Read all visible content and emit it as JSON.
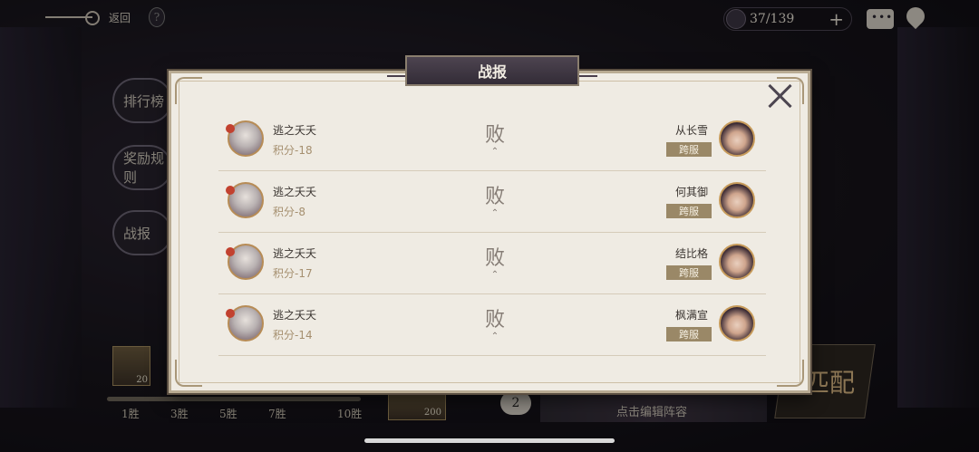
{
  "topbar": {
    "back_label": "返回",
    "help_glyph": "?",
    "ticket_count": "37/139",
    "plus_glyph": "+"
  },
  "sidebar": {
    "items": [
      {
        "label": "排行榜"
      },
      {
        "label": "奖励规则"
      },
      {
        "label": "战报"
      }
    ]
  },
  "progress": {
    "labels": [
      "1胜",
      "3胜",
      "5胜",
      "7胜",
      "10胜"
    ]
  },
  "rewards": {
    "box1_count": "20",
    "box2_count": "200"
  },
  "lineup": {
    "badge": "2",
    "hint": "点击编辑阵容"
  },
  "match_button": {
    "label": "匹配"
  },
  "modal": {
    "title": "战报",
    "records": [
      {
        "my_name": "逃之夭夭",
        "my_score": "积分-18",
        "result": "败",
        "opponent": "从长雪",
        "server": "跨服"
      },
      {
        "my_name": "逃之夭夭",
        "my_score": "积分-8",
        "result": "败",
        "opponent": "何其御",
        "server": "跨服"
      },
      {
        "my_name": "逃之夭夭",
        "my_score": "积分-17",
        "result": "败",
        "opponent": "结比格",
        "server": "跨服"
      },
      {
        "my_name": "逃之夭夭",
        "my_score": "积分-14",
        "result": "败",
        "opponent": "枫满宣",
        "server": "跨服"
      }
    ]
  },
  "colors": {
    "panel_bg": "#efebe3",
    "tag_bg": "#9a8867",
    "score_text": "#a58f6f"
  }
}
